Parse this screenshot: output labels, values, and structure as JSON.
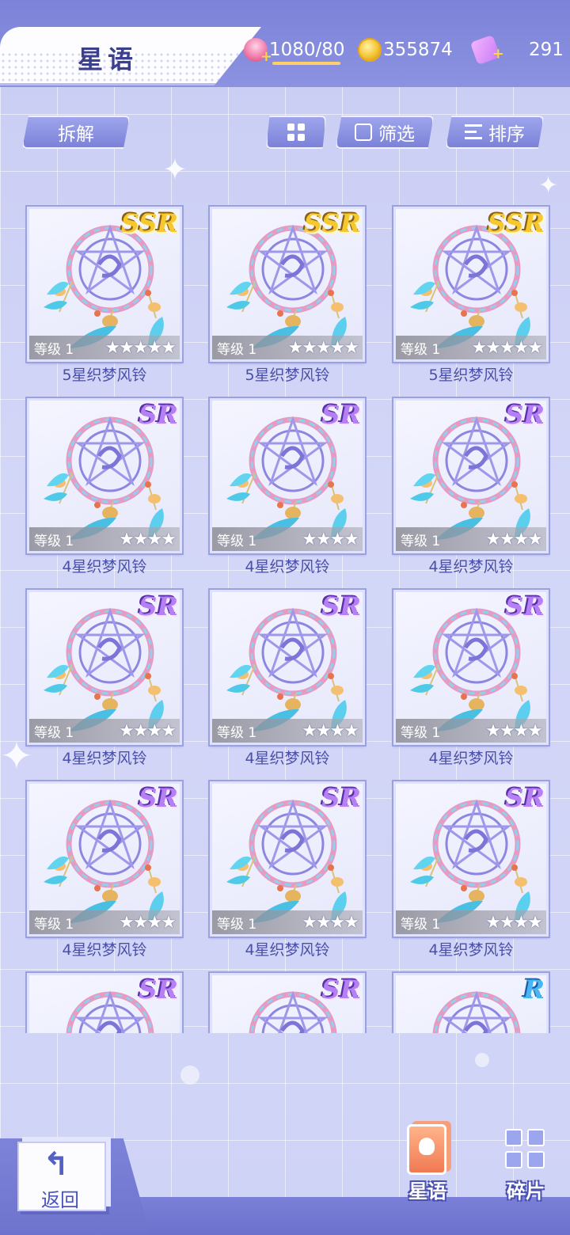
{
  "header": {
    "title": "星语",
    "stamina": "1080/80",
    "coins": "355874",
    "gems": "291"
  },
  "toolbar": {
    "disassemble_label": "拆解",
    "filter_label": "筛选",
    "sort_label": "排序"
  },
  "cards": [
    {
      "name": "5星织梦风铃",
      "rarity": "SSR",
      "level": "等级 1",
      "stars": "★★★★★"
    },
    {
      "name": "5星织梦风铃",
      "rarity": "SSR",
      "level": "等级 1",
      "stars": "★★★★★"
    },
    {
      "name": "5星织梦风铃",
      "rarity": "SSR",
      "level": "等级 1",
      "stars": "★★★★★"
    },
    {
      "name": "4星织梦风铃",
      "rarity": "SR",
      "level": "等级 1",
      "stars": "★★★★"
    },
    {
      "name": "4星织梦风铃",
      "rarity": "SR",
      "level": "等级 1",
      "stars": "★★★★"
    },
    {
      "name": "4星织梦风铃",
      "rarity": "SR",
      "level": "等级 1",
      "stars": "★★★★"
    },
    {
      "name": "4星织梦风铃",
      "rarity": "SR",
      "level": "等级 1",
      "stars": "★★★★"
    },
    {
      "name": "4星织梦风铃",
      "rarity": "SR",
      "level": "等级 1",
      "stars": "★★★★"
    },
    {
      "name": "4星织梦风铃",
      "rarity": "SR",
      "level": "等级 1",
      "stars": "★★★★"
    },
    {
      "name": "4星织梦风铃",
      "rarity": "SR",
      "level": "等级 1",
      "stars": "★★★★"
    },
    {
      "name": "4星织梦风铃",
      "rarity": "SR",
      "level": "等级 1",
      "stars": "★★★★"
    },
    {
      "name": "4星织梦风铃",
      "rarity": "SR",
      "level": "等级 1",
      "stars": "★★★★"
    },
    {
      "name": "",
      "rarity": "SR",
      "level": "",
      "stars": ""
    },
    {
      "name": "",
      "rarity": "SR",
      "level": "",
      "stars": ""
    },
    {
      "name": "",
      "rarity": "R",
      "level": "",
      "stars": ""
    }
  ],
  "bottom_nav": {
    "back_label": "返回",
    "star_words_label": "星语",
    "fragments_label": "碎片"
  }
}
